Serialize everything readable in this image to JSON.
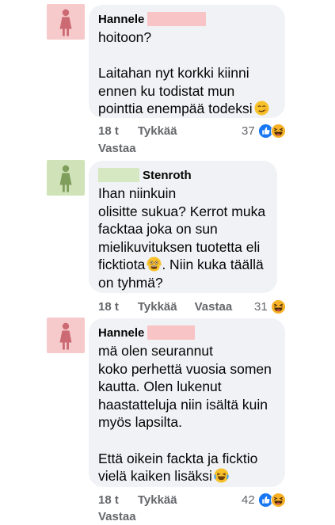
{
  "comments": [
    {
      "author": "Hannele",
      "author_before": "",
      "avatar_color": "#f6c9cb",
      "figure_color": "#cc6a73",
      "redact_color": "#f8c4c6",
      "text": "hoitoon?\n\nLaitahan nyt korkki kiinni\nennen ku todistat mun\npointtia enempää todeksi",
      "emoji": "smirk-emoji",
      "time": "18 t",
      "like": "Tykkää",
      "reply": "Vastaa",
      "reaction_count": "37",
      "reactions": [
        "like-reaction-icon",
        "haha-reaction-icon"
      ]
    },
    {
      "author": "Stenroth",
      "author_before": "",
      "avatar_color": "#cfe2b8",
      "figure_color": "#7f9e5c",
      "redact_color": "#d6e8c2",
      "text": "Ihan niinkuin\nolisitte sukua? Kerrot muka\nfacktaa joka on sun\nmielikuvituksen tuotetta eli\nficktiota",
      "emoji": "shocked-emoji",
      "text_after": ". Niin kuka täällä\non tyhmä?",
      "time": "18 t",
      "like": "Tykkää",
      "reply": "Vastaa",
      "reaction_count": "31",
      "reactions": [
        "haha-reaction-icon"
      ]
    },
    {
      "author": "Hannele",
      "author_before": "",
      "avatar_color": "#f6c9cb",
      "figure_color": "#cc6a73",
      "redact_color": "#f8c4c6",
      "text": "mä olen seurannut\nkoko perhettä vuosia somen\nkautta. Olen lukenut\nhaastatteluja niin isältä kuin\nmyös lapsilta.\n\nEttä oikein fackta ja ficktio\nvielä kaiken lisäksi",
      "emoji": "laughing-emoji",
      "time": "18 t",
      "like": "Tykkää",
      "reply": "Vastaa",
      "reaction_count": "42",
      "reactions": [
        "like-reaction-icon",
        "haha-reaction-icon"
      ]
    }
  ],
  "colors": {
    "bubble": "#f0f2f5",
    "meta_text": "#65676b",
    "like_blue": "#1877f2",
    "haha_yellow": "#f7b125"
  }
}
